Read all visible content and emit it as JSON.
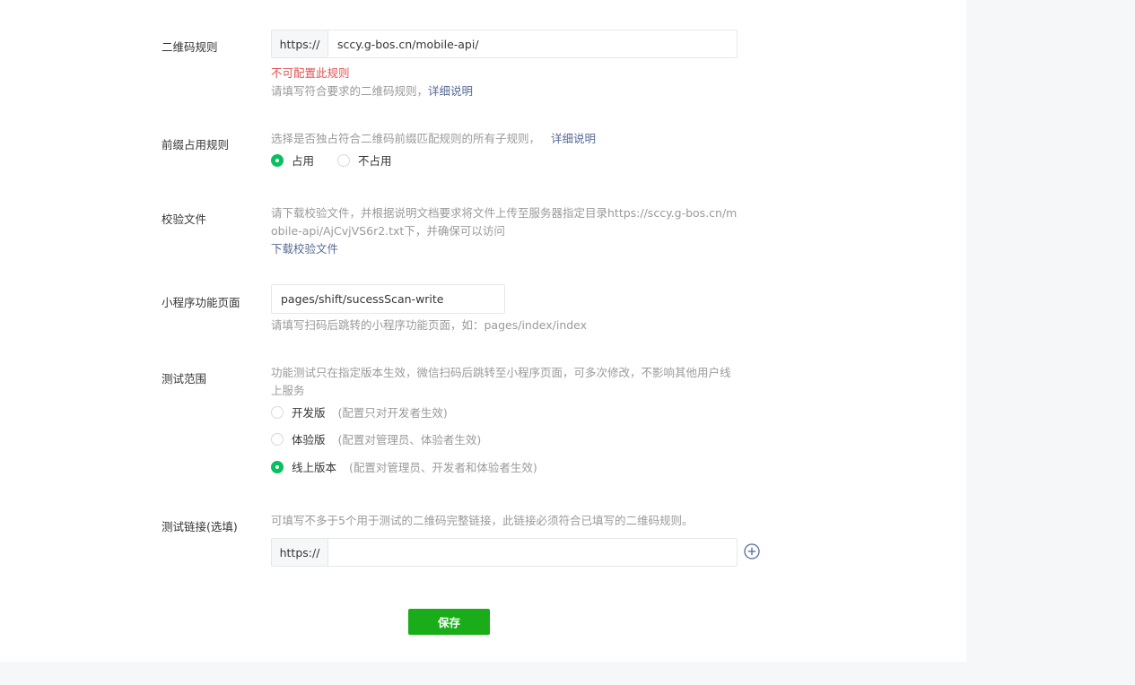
{
  "qr_rule": {
    "label": "二维码规则",
    "prefix": "https://",
    "value": "sccy.g-bos.cn/mobile-api/",
    "error": "不可配置此规则",
    "hint": "请填写符合要求的二维码规则，",
    "hint_link": "详细说明"
  },
  "prefix_rule": {
    "label": "前缀占用规则",
    "hint": "选择是否独占符合二维码前缀匹配规则的所有子规则，",
    "hint_link": "详细说明",
    "options": [
      {
        "label": "占用",
        "checked": true
      },
      {
        "label": "不占用",
        "checked": false
      }
    ]
  },
  "verify_file": {
    "label": "校验文件",
    "hint_line1": "请下载校验文件，并根据说明文档要求将文件上传至服务器指定目录https://sccy.g-bos.cn/m",
    "hint_line2": "obile-api/AjCvjVS6r2.txt下，并确保可以访问",
    "download_link": "下载校验文件"
  },
  "mini_page": {
    "label": "小程序功能页面",
    "value": "pages/shift/sucessScan-write",
    "hint": "请填写扫码后跳转的小程序功能页面，如：pages/index/index"
  },
  "test_scope": {
    "label": "测试范围",
    "hint_line1": "功能测试只在指定版本生效，微信扫码后跳转至小程序页面，可多次修改，不影响其他用户线",
    "hint_line2": "上服务",
    "options": [
      {
        "label": "开发版",
        "note": "(配置只对开发者生效)",
        "checked": false
      },
      {
        "label": "体验版",
        "note": "(配置对管理员、体验者生效)",
        "checked": false
      },
      {
        "label": "线上版本",
        "note": "(配置对管理员、开发者和体验者生效)",
        "checked": true
      }
    ]
  },
  "test_link": {
    "label": "测试链接(选填)",
    "hint": "可填写不多于5个用于测试的二维码完整链接，此链接必须符合已填写的二维码规则。",
    "prefix": "https://",
    "value": ""
  },
  "save_label": "保存",
  "colors": {
    "accent": "#07c160",
    "save_button": "#1aad19",
    "link": "#576b95",
    "error": "#e15151"
  },
  "icons": {
    "add": "plus-circle-icon"
  }
}
